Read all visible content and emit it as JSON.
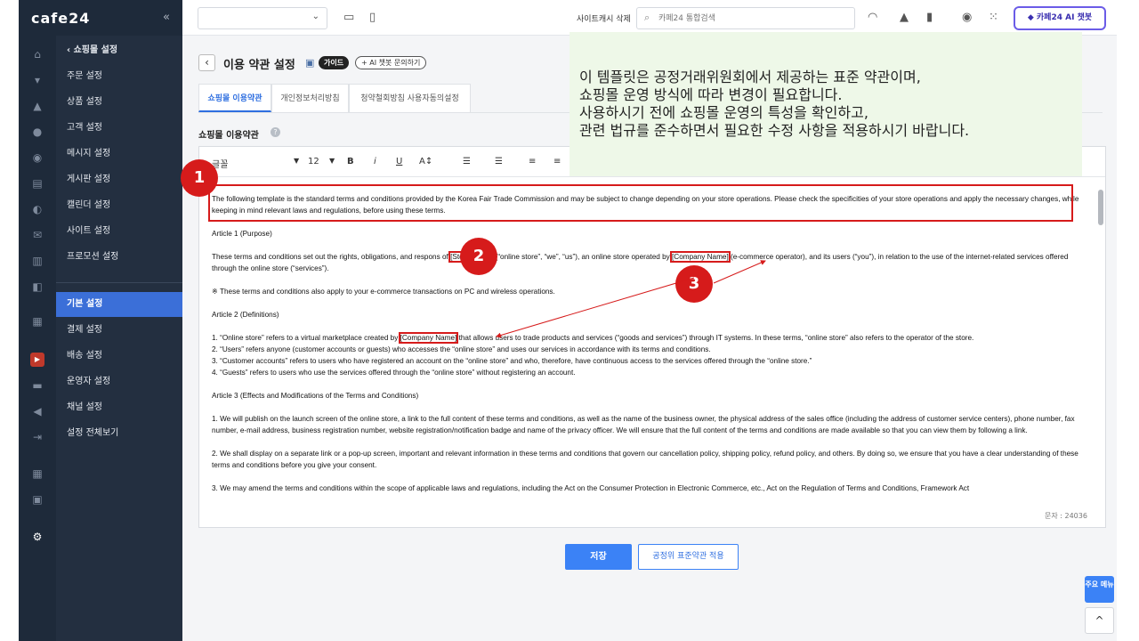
{
  "app": {
    "logo": "cafe24",
    "collapse": "«"
  },
  "topbar": {
    "shop_select": "",
    "cache_delete": "사이트캐시 삭제",
    "search_placeholder": "카페24 통합검색",
    "ai_chatbot": "카페24 AI 챗봇"
  },
  "submenu": {
    "back": "‹ 쇼핑몰 설정",
    "items": [
      "주문 설정",
      "상품 설정",
      "고객 설정",
      "메시지 설정",
      "게시판 설정",
      "캘린더 설정",
      "사이트 설정",
      "프로모션 설정"
    ],
    "items2": [
      "기본 설정",
      "결제 설정",
      "배송 설정",
      "운영자 설정",
      "채널 설정",
      "설정 전체보기"
    ],
    "active": "기본 설정"
  },
  "page": {
    "title": "이용 약관 설정",
    "guide": "가이드",
    "ai_ask": "+ AI 챗봇 문의하기",
    "tabs": [
      "쇼핑몰 이용약관",
      "개인정보처리방침",
      "청약철회방침 사용자동의설정"
    ],
    "section_title": "쇼핑몰 이용약관"
  },
  "toolbar": {
    "font": "글꼴",
    "size": "12",
    "bold": "B",
    "italic": "i",
    "underline": "U",
    "fontsize": "A↕"
  },
  "doc": {
    "intro": "The following template is the standard terms and conditions provided by the Korea Fair Trade Commission and may be subject to change depending on your store operations. Please check the specificities of your store operations and apply the necessary changes, while keeping in mind relevant laws and regulations, before using these terms.",
    "a1_title": "Article 1 (Purpose)",
    "a1_p1a": "These terms and conditions set out the rights, obligations, and respo",
    "a1_p1b": "ns",
    "a1_p1c": " of ",
    "store_name": "[Store Name]",
    "a1_p1d": " (“online store”, “we”, “us”), an online store operated by ",
    "company_name": "[Company Name]",
    "a1_p1e": " (e-commerce operator), and its users (“you”), in relation to the use of the internet-related services offered through the online store (“services”).",
    "a1_note": "※ These terms and conditions also apply to your e-commerce transactions on PC and wireless operations.",
    "a2_title": "Article 2 (Definitions)",
    "a2_1a": "1. “Online store” refers to a virtual marketplace created by ",
    "a2_1b": " that allows users to trade products and services (“goods and services”) through IT systems. In these terms, “online store” also refers to the operator of the store.",
    "a2_2": "2. “Users” refers anyone (customer accounts or guests) who accesses the “online store” and uses our services in accordance with its terms and conditions.",
    "a2_3": "3. “Customer accounts” refers to users who have registered an account on the “online store” and who, therefore, have continuous access to the services offered through the “online store.”",
    "a2_4": "4. “Guests” refers to users who use the services offered through the “online store” without registering an account.",
    "a3_title": "Article 3 (Effects and Modifications of the Terms and Conditions)",
    "a3_1": "1. We will publish on the launch screen of the online store, a link to the full content of these terms and conditions, as well as the name of the business owner, the physical address of the sales office (including the address of customer service centers), phone number, fax number, e-mail address, business registration number, website registration/notification badge and name of the privacy officer. We will ensure that the full content of the terms and conditions are made available so that you can view them by following a link.",
    "a3_2": "2. We shall display on a separate link or a pop-up screen, important and relevant information in these terms and conditions that govern our cancellation policy, shipping policy, refund policy, and others. By doing so, we ensure that you have a clear understanding of these terms and conditions before you give your consent.",
    "a3_3": "3. We may amend the terms and conditions within the scope of applicable laws and regulations, including the Act on the Consumer Protection in Electronic Commerce, etc., Act on the Regulation of Terms and Conditions, Framework Act"
  },
  "char_count": "문자 : 24036",
  "buttons": {
    "save": "저장",
    "apply_standard": "공정위 표준약관 적용",
    "main_menu": "주요 메뉴",
    "to_top": "^"
  },
  "callout": {
    "text": "이 템플릿은 공정거래위원회에서 제공하는 표준 약관이며,\n쇼핑몰 운영 방식에 따라 변경이 필요합니다.\n사용하시기 전에 쇼핑몰 운영의 특성을 확인하고,\n관련 법규를 준수하면서 필요한 수정 사항을 적용하시기 바랍니다."
  },
  "markers": [
    "1",
    "2",
    "3"
  ],
  "colors": {
    "accent": "#3b82f6",
    "marker": "#d61b1b",
    "sidebar": "#232f40",
    "callout_bg": "#eef8e8"
  }
}
